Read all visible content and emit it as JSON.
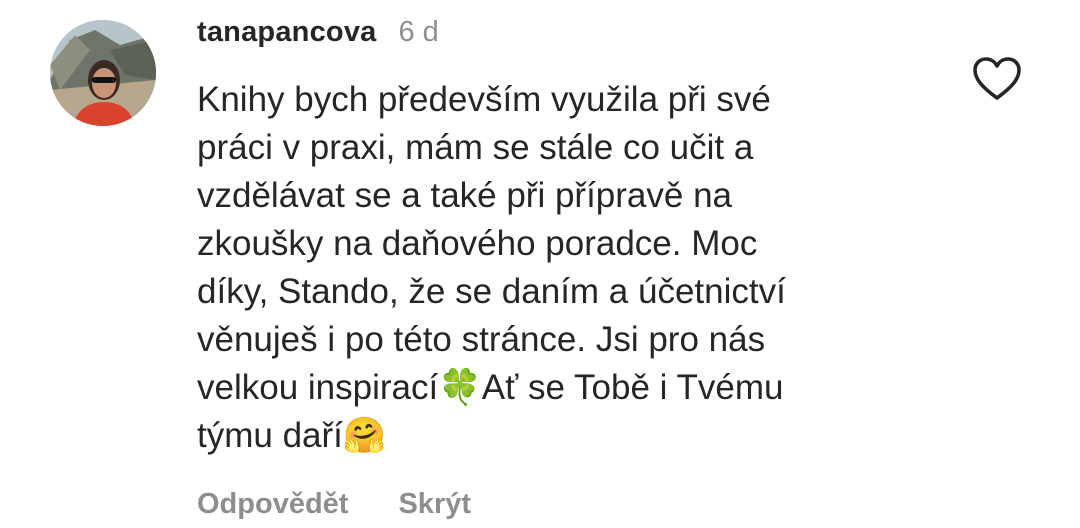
{
  "comment": {
    "username": "tanapancova",
    "time": "6 d",
    "text": "Knihy bych především využila při své\npráci v praxi, mám se stále co učit a\nvzdělávat se a také při přípravě na\nzkoušky na daňového poradce. Moc\ndíky, Stando, že se daním a účetnictví\nvěnuješ i po této stránce. Jsi pro nás\nvelkou inspirací🍀Ať se Tobě i Tvému\ntýmu daří🤗",
    "reply_label": "Odpovědět",
    "hide_label": "Skrýt",
    "like_icon": "heart-outline-icon",
    "avatar_icon": "user-avatar"
  },
  "colors": {
    "text": "#262626",
    "muted": "#8e8e8e",
    "background": "#ffffff"
  }
}
